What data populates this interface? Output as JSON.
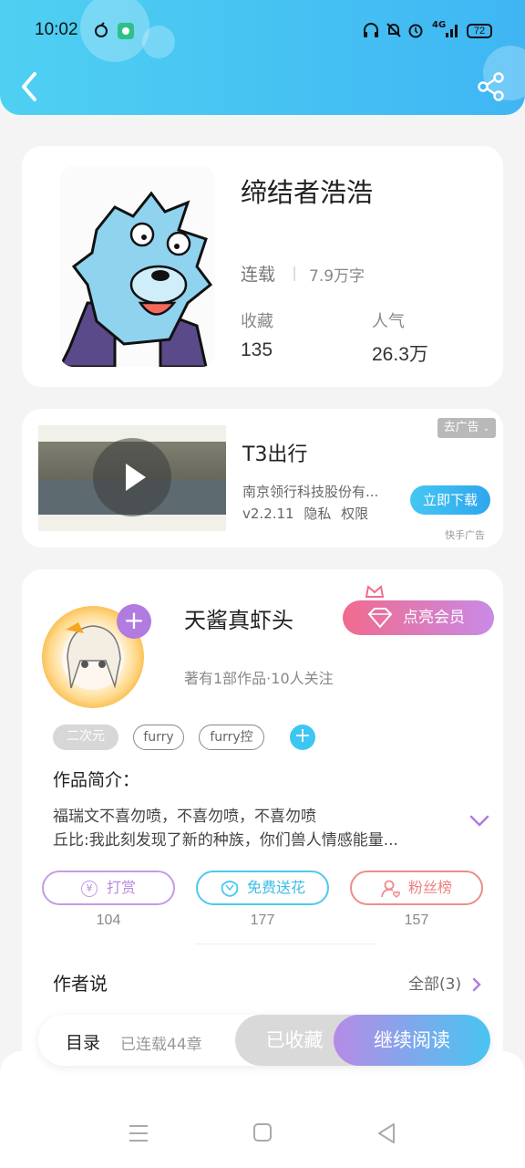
{
  "status_bar": {
    "time": "10:02",
    "battery": "72",
    "network": "4G"
  },
  "header": {
    "back_icon": "chevron-left-icon",
    "share_icon": "share-icon"
  },
  "book": {
    "title": "缔结者浩浩",
    "status": "连载",
    "word_count": "7.9万字",
    "favorites_label": "收藏",
    "favorites_value": "135",
    "popularity_label": "人气",
    "popularity_value": "26.3万"
  },
  "ad": {
    "title": "T3出行",
    "company": "南京领行科技股份有...",
    "version": "v2.2.11",
    "privacy": "隐私",
    "permissions": "权限",
    "close_label": "去广告",
    "download_label": "立即下载",
    "source": "快手广告"
  },
  "author": {
    "name": "天酱真虾头",
    "vip_label": "点亮会员",
    "meta": "著有1部作品·10人关注",
    "tags": [
      "二次元",
      "furry",
      "furry控"
    ],
    "intro_label": "作品简介：",
    "intro_lines": [
      "福瑞文不喜勿喷，不喜勿喷，不喜勿喷",
      "丘比:我此刻发现了新的种族，你们兽人情感能量..."
    ],
    "actions": [
      {
        "label": "打赏",
        "count": "104",
        "icon": "yen-icon",
        "color": "#c59be6"
      },
      {
        "label": "免费送花",
        "count": "177",
        "icon": "flower-icon",
        "color": "#4ec9ee"
      },
      {
        "label": "粉丝榜",
        "count": "157",
        "icon": "user-heart-icon",
        "color": "#ef8c8c"
      }
    ],
    "author_say_label": "作者说",
    "all_label": "全部(3)"
  },
  "bottom_bar": {
    "toc_label": "目录",
    "serial_label": "已连载44章",
    "collected_label": "已收藏",
    "continue_label": "继续阅读"
  },
  "nav": {
    "menu_icon": "menu-icon",
    "home_icon": "home-square-icon",
    "back_icon": "back-triangle-icon"
  }
}
